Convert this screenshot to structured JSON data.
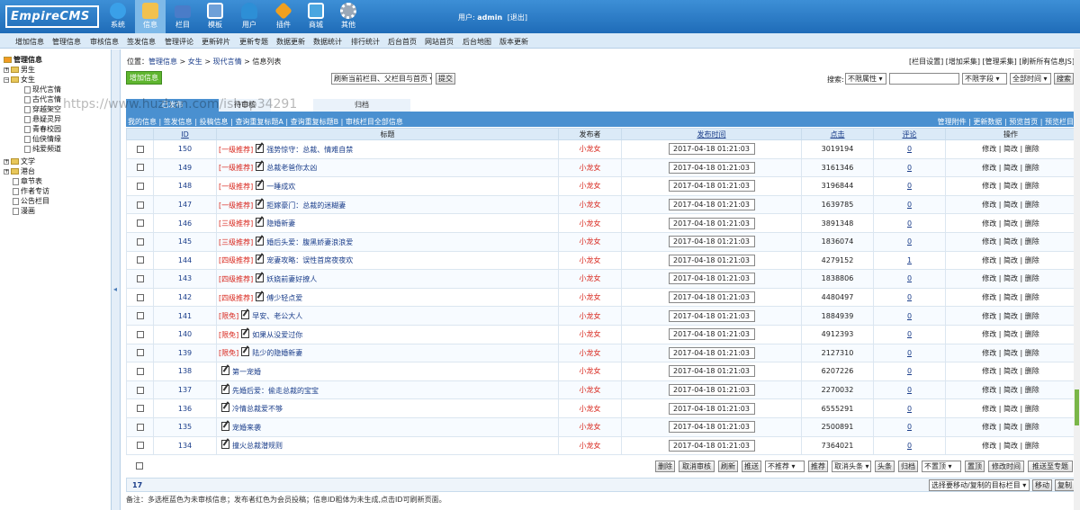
{
  "header": {
    "logo": "EmpireCMS",
    "nav": [
      {
        "label": "系统",
        "icon": "globe-icon",
        "color": "#3aa0e8"
      },
      {
        "label": "信息",
        "icon": "note-edit-icon",
        "color": "#f2c14e"
      },
      {
        "label": "栏目",
        "icon": "folder-icon",
        "color": "#4a7cc8"
      },
      {
        "label": "模板",
        "icon": "template-icon",
        "color": "#6ea0d8"
      },
      {
        "label": "用户",
        "icon": "user-icon",
        "color": "#2d8fd6"
      },
      {
        "label": "插件",
        "icon": "tools-icon",
        "color": "#f0a020"
      },
      {
        "label": "商城",
        "icon": "shop-icon",
        "color": "#4aa6e0"
      },
      {
        "label": "其他",
        "icon": "gear-icon",
        "color": "#9aa8b8"
      }
    ],
    "user_label": "用户: ",
    "username": "admin",
    "logout": "[退出]"
  },
  "submenu": [
    "增加信息",
    "管理信息",
    "审核信息",
    "签发信息",
    "管理评论",
    "更新碎片",
    "更新专题",
    "数据更新",
    "数据统计",
    "排行统计",
    "后台首页",
    "网站首页",
    "后台地图",
    "版本更新"
  ],
  "sidebar": {
    "root": "管理信息",
    "nodes": [
      {
        "label": "男生",
        "level": 0,
        "kind": "folder-plus"
      },
      {
        "label": "女生",
        "level": 0,
        "kind": "folder-minus"
      },
      {
        "label": "现代言情",
        "level": 1,
        "kind": "page"
      },
      {
        "label": "古代言情",
        "level": 1,
        "kind": "page"
      },
      {
        "label": "穿越架空",
        "level": 1,
        "kind": "page"
      },
      {
        "label": "悬疑灵异",
        "level": 1,
        "kind": "page"
      },
      {
        "label": "青春校园",
        "level": 1,
        "kind": "page"
      },
      {
        "label": "仙侠情缘",
        "level": 1,
        "kind": "page"
      },
      {
        "label": "纯爱频道",
        "level": 1,
        "kind": "page"
      },
      {
        "label": "文学",
        "level": 0,
        "kind": "folder-plus"
      },
      {
        "label": "港台",
        "level": 0,
        "kind": "folder-plus"
      },
      {
        "label": "章节表",
        "level": 0,
        "kind": "page"
      },
      {
        "label": "作者专访",
        "level": 0,
        "kind": "page"
      },
      {
        "label": "公告栏目",
        "level": 0,
        "kind": "page"
      },
      {
        "label": "漫画",
        "level": 0,
        "kind": "page"
      }
    ]
  },
  "breadcrumb": {
    "prefix": "位置：",
    "p1": "管理信息",
    "sep": " > ",
    "p2": "女生",
    "p3": "现代言情",
    "p4": "信息列表"
  },
  "toplinks": "[栏目设置] [增加采集] [管理采集] [刷新所有信息JS]",
  "toolbar": {
    "add_label": "增加信息",
    "refresh_select": "刷新当前栏目、父栏目与首页",
    "submit_label": "提交",
    "search_label": "搜索:",
    "attr_select": "不限属性",
    "field_select": "不限字段",
    "time_select": "全部时间",
    "search_button": "搜索"
  },
  "tabs": [
    "已发布",
    "待审核",
    "归档"
  ],
  "linkbar": {
    "left": "我的信息 | 签发信息 | 投稿信息 | 查询重复标题A | 查询重复标题B | 审核栏目全部信息",
    "right": "管理附件 | 更新数据 | 预览首页 | 预览栏目"
  },
  "table": {
    "headers": {
      "id": "ID",
      "title": "标题",
      "publisher": "发布者",
      "time": "发布时间",
      "clicks": "点击",
      "comments": "评论",
      "ops": "操作"
    },
    "ops_label": "修改 | 简改 | 删除",
    "rows": [
      {
        "id": "150",
        "tag": "[一级推荐]",
        "title": "强势惊守：总裁、情难自禁",
        "publisher": "小龙女",
        "time": "2017-04-18 01:21:03",
        "clicks": "3019194",
        "comments": "0"
      },
      {
        "id": "149",
        "tag": "[一级推荐]",
        "title": "总裁老爸你太凶",
        "publisher": "小龙女",
        "time": "2017-04-18 01:21:03",
        "clicks": "3161346",
        "comments": "0"
      },
      {
        "id": "148",
        "tag": "[一级推荐]",
        "title": "一睡成欢",
        "publisher": "小龙女",
        "time": "2017-04-18 01:21:03",
        "clicks": "3196844",
        "comments": "0"
      },
      {
        "id": "147",
        "tag": "[一级推荐]",
        "title": "拒嫁豪门：总裁的迷糊妻",
        "publisher": "小龙女",
        "time": "2017-04-18 01:21:03",
        "clicks": "1639785",
        "comments": "0"
      },
      {
        "id": "146",
        "tag": "[三级推荐]",
        "title": "隐婚新妻",
        "publisher": "小龙女",
        "time": "2017-04-18 01:21:03",
        "clicks": "3891348",
        "comments": "0"
      },
      {
        "id": "145",
        "tag": "[三级推荐]",
        "title": "婚后头爱：腹黑娇妻浪浪爱",
        "publisher": "小龙女",
        "time": "2017-04-18 01:21:03",
        "clicks": "1836074",
        "comments": "0"
      },
      {
        "id": "144",
        "tag": "[四级推荐]",
        "title": "宠妻攻略：误性首席夜夜欢",
        "publisher": "小龙女",
        "time": "2017-04-18 01:21:03",
        "clicks": "4279152",
        "comments": "1"
      },
      {
        "id": "143",
        "tag": "[四级推荐]",
        "title": "妖娆前妻好撩人",
        "publisher": "小龙女",
        "time": "2017-04-18 01:21:03",
        "clicks": "1838806",
        "comments": "0"
      },
      {
        "id": "142",
        "tag": "[四级推荐]",
        "title": "傅少轻点爱",
        "publisher": "小龙女",
        "time": "2017-04-18 01:21:03",
        "clicks": "4480497",
        "comments": "0"
      },
      {
        "id": "141",
        "tag": "[限免]",
        "title": "早安、老公大人",
        "publisher": "小龙女",
        "time": "2017-04-18 01:21:03",
        "clicks": "1884939",
        "comments": "0"
      },
      {
        "id": "140",
        "tag": "[限免]",
        "title": "如果从没爱过你",
        "publisher": "小龙女",
        "time": "2017-04-18 01:21:03",
        "clicks": "4912393",
        "comments": "0"
      },
      {
        "id": "139",
        "tag": "[限免]",
        "title": "陆少的隐婚新妻",
        "publisher": "小龙女",
        "time": "2017-04-18 01:21:03",
        "clicks": "2127310",
        "comments": "0"
      },
      {
        "id": "138",
        "tag": "",
        "title": "第一宠婚",
        "publisher": "小龙女",
        "time": "2017-04-18 01:21:03",
        "clicks": "6207226",
        "comments": "0"
      },
      {
        "id": "137",
        "tag": "",
        "title": "先婚后爱：偷走总裁的宝宝",
        "publisher": "小龙女",
        "time": "2017-04-18 01:21:03",
        "clicks": "2270032",
        "comments": "0"
      },
      {
        "id": "136",
        "tag": "",
        "title": "冷情总裁爱不够",
        "publisher": "小龙女",
        "time": "2017-04-18 01:21:03",
        "clicks": "6555291",
        "comments": "0"
      },
      {
        "id": "135",
        "tag": "",
        "title": "宠婚来袭",
        "publisher": "小龙女",
        "time": "2017-04-18 01:21:03",
        "clicks": "2500891",
        "comments": "0"
      },
      {
        "id": "134",
        "tag": "",
        "title": "撞火总裁潜规则",
        "publisher": "小龙女",
        "time": "2017-04-18 01:21:03",
        "clicks": "7364021",
        "comments": "0"
      }
    ]
  },
  "actions": {
    "delete": "删除",
    "cancel_audit": "取消审核",
    "refresh": "刷新",
    "push": "推送",
    "no_recommend": "不推荐",
    "recommend": "推荐",
    "cancel_headline": "取消头条",
    "headline": "头条",
    "archive": "归档",
    "no_top": "不置顶",
    "set_top": "置顶",
    "edit_time": "修改时间",
    "push_topic": "推送至专题"
  },
  "pager": {
    "count": "17",
    "move_select": "选择要移动/复制的目标栏目",
    "move": "移动",
    "copy": "复制"
  },
  "note": "备注：多选框蓝色为未审核信息；发布者红色为会员投稿；信息ID粗体为未生成,点击ID可刷新页面。",
  "watermark": "https://www.huzhan.com/ishop34291"
}
